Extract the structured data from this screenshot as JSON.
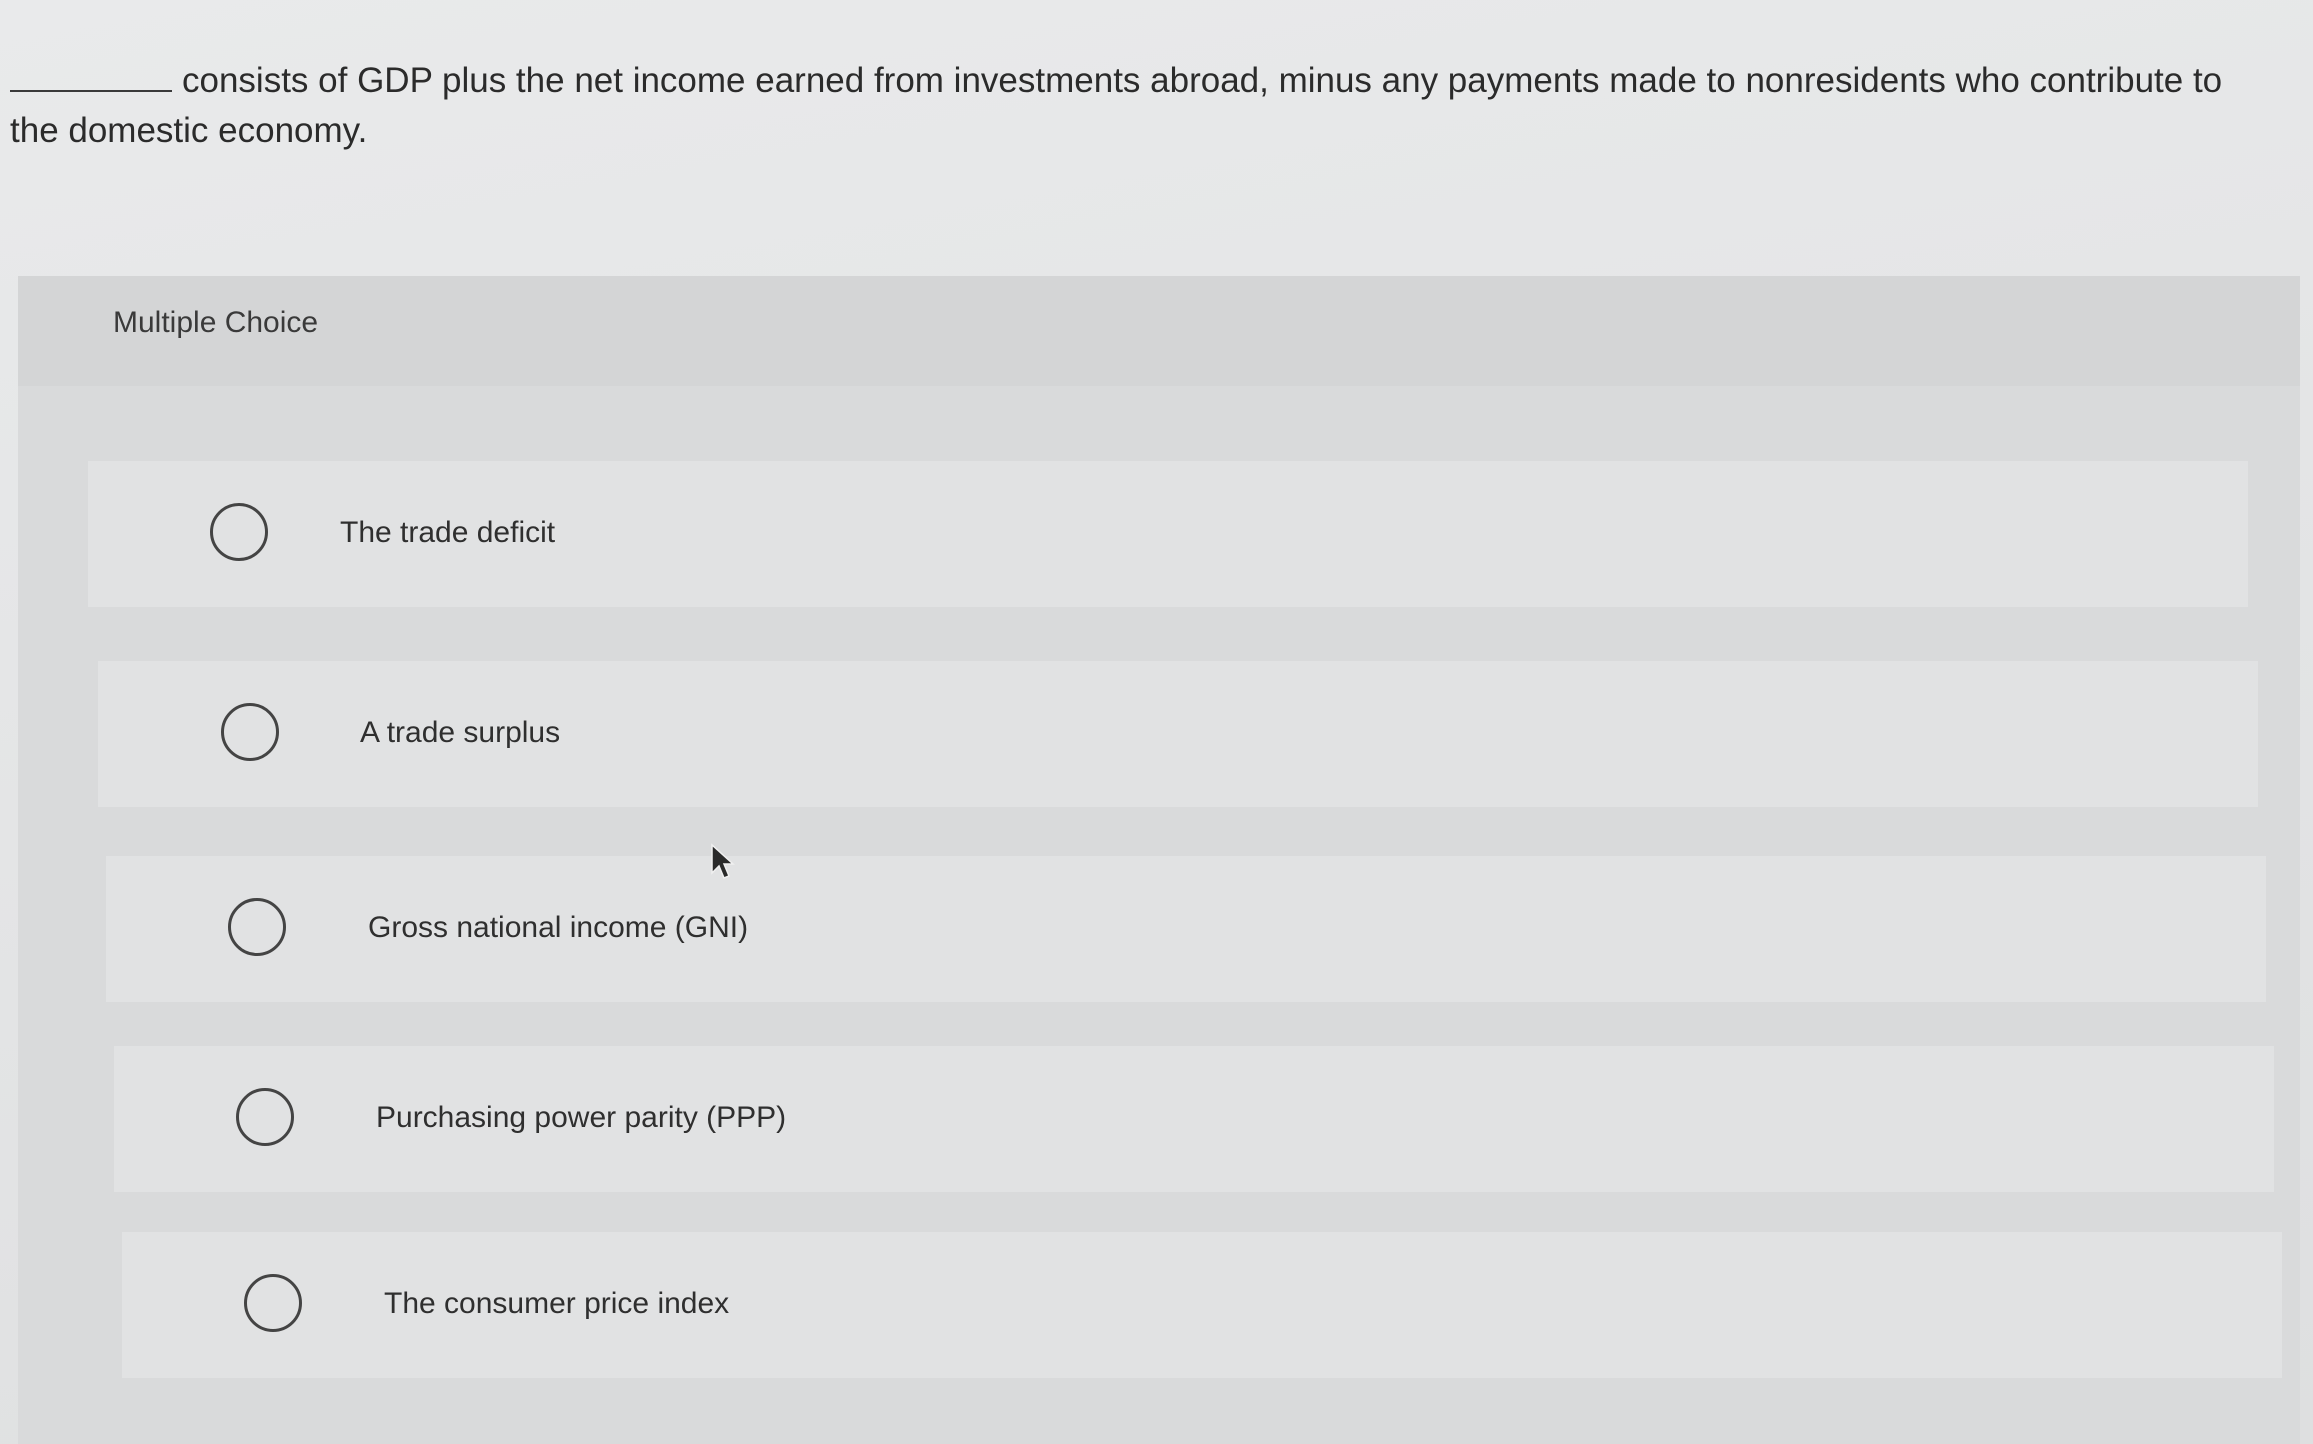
{
  "question": {
    "text": "consists of GDP plus the net income earned from investments abroad, minus any payments made to nonresidents who contribute to the domestic economy."
  },
  "panel": {
    "title": "Multiple Choice"
  },
  "options": [
    {
      "label": "The trade deficit"
    },
    {
      "label": "A trade surplus"
    },
    {
      "label": "Gross national income (GNI)"
    },
    {
      "label": "Purchasing power parity (PPP)"
    },
    {
      "label": "The consumer price index"
    }
  ],
  "icons": {
    "cursor": "mouse-pointer-icon",
    "radio": "radio-unselected-icon"
  }
}
